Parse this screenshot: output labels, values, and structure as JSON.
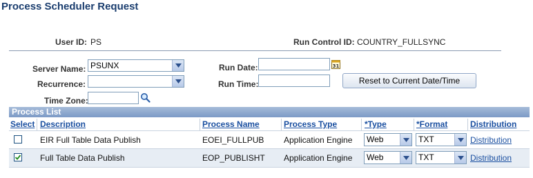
{
  "page_title": "Process Scheduler Request",
  "user_id": {
    "label": "User ID:",
    "value": "PS"
  },
  "run_control_id": {
    "label": "Run Control ID:",
    "value": "COUNTRY_FULLSYNC"
  },
  "server_name": {
    "label": "Server Name:",
    "value": "PSUNX"
  },
  "recurrence": {
    "label": "Recurrence:",
    "value": ""
  },
  "time_zone": {
    "label": "Time Zone:",
    "value": ""
  },
  "run_date": {
    "label": "Run Date:",
    "value": ""
  },
  "run_time": {
    "label": "Run Time:",
    "value": ""
  },
  "reset_button": "Reset to Current Date/Time",
  "process_list": {
    "title": "Process List",
    "columns": {
      "select": "Select",
      "description": "Description",
      "process_name": "Process Name",
      "process_type": "Process Type",
      "type": "*Type",
      "format": "*Format",
      "distribution": "Distribution"
    },
    "rows": [
      {
        "selected": false,
        "description": "EIR Full Table Data Publish",
        "process_name": "EOEI_FULLPUB",
        "process_type": "Application Engine",
        "type": "Web",
        "format": "TXT",
        "distribution": "Distribution"
      },
      {
        "selected": true,
        "description": "Full Table Data Publish",
        "process_name": "EOP_PUBLISHT",
        "process_type": "Application Engine",
        "type": "Web",
        "format": "TXT",
        "distribution": "Distribution"
      }
    ]
  },
  "colors": {
    "title": "#1a3d6e",
    "link": "#1a4fa0",
    "grid_header": "#7c9ac6"
  },
  "icons": {
    "calendar": "calendar-icon",
    "lookup": "magnifier-icon",
    "dropdown": "chevron-down-icon"
  }
}
